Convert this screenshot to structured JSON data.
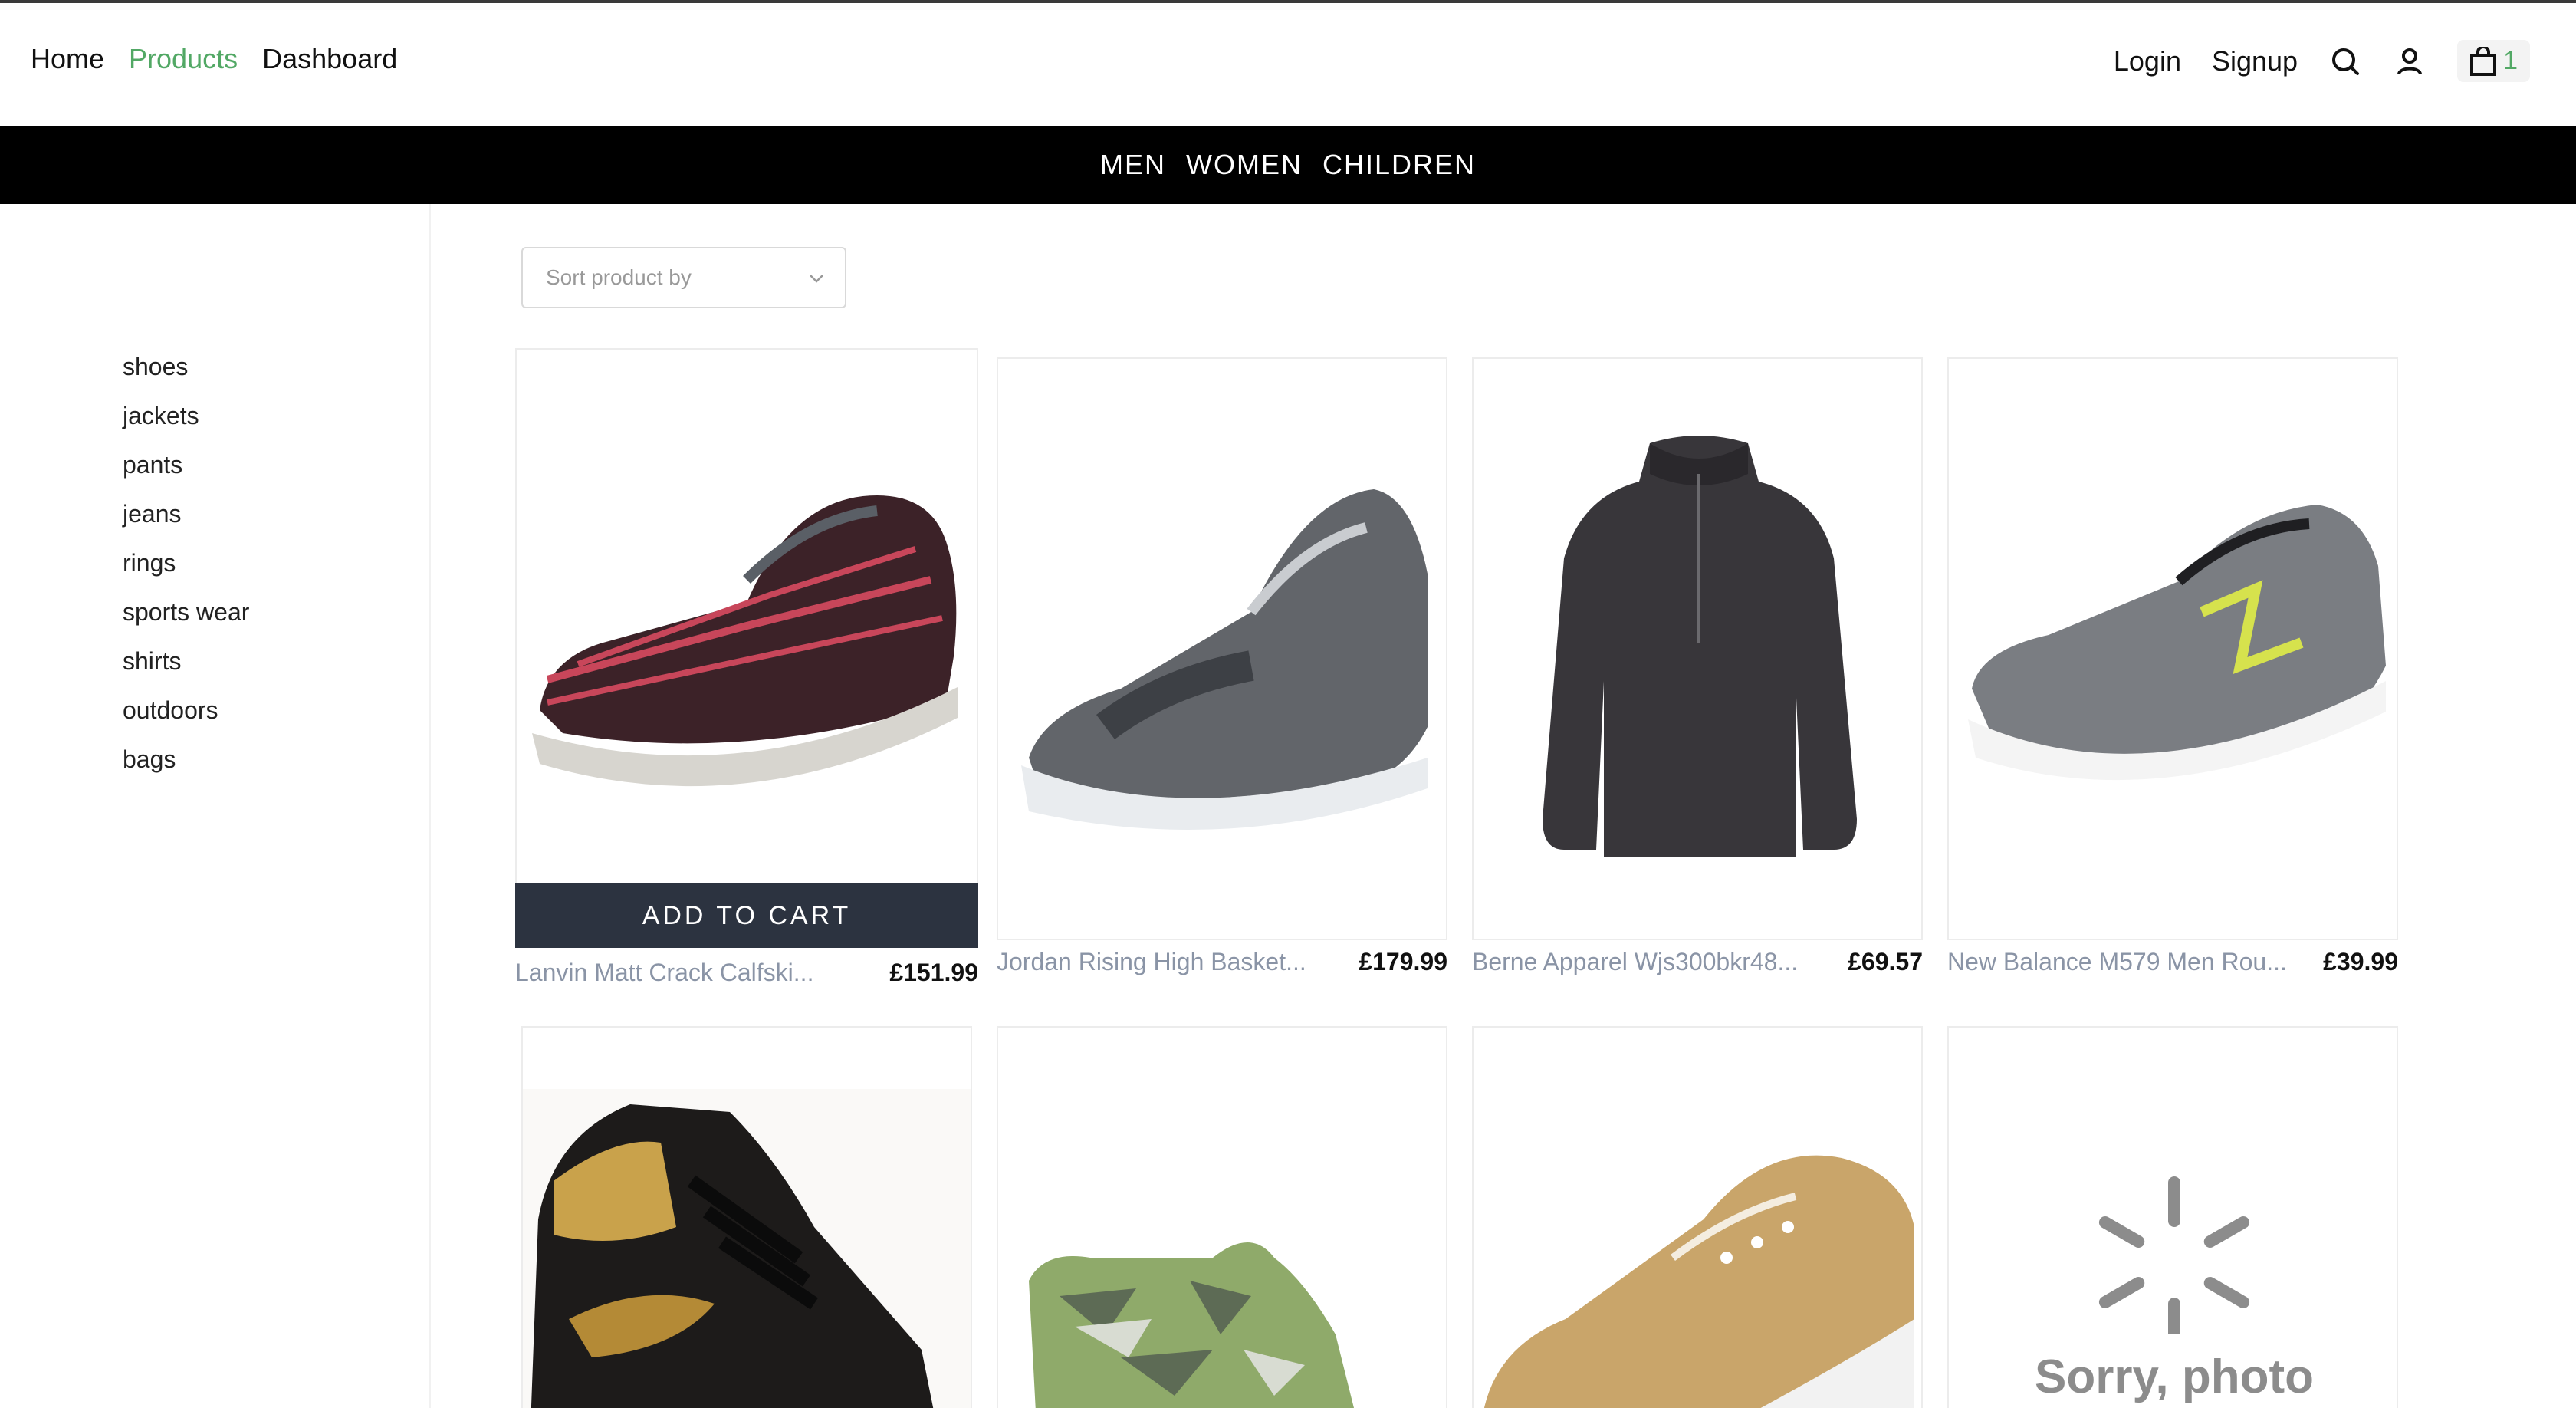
{
  "header": {
    "nav": [
      {
        "label": "Home",
        "active": false
      },
      {
        "label": "Products",
        "active": true
      },
      {
        "label": "Dashboard",
        "active": false
      }
    ],
    "login": "Login",
    "signup": "Signup",
    "cart_count": "1",
    "icons": [
      "search-icon",
      "user-icon",
      "shopping-bag-icon"
    ]
  },
  "categories": [
    "MEN",
    "WOMEN",
    "CHILDREN"
  ],
  "sidebar": {
    "items": [
      "shoes",
      "jackets",
      "pants",
      "jeans",
      "rings",
      "sports wear",
      "shirts",
      "outdoors",
      "bags"
    ]
  },
  "sort": {
    "placeholder": "Sort product by"
  },
  "add_to_cart": "ADD TO CART",
  "products": [
    {
      "name": "Lanvin Matt Crack Calfski...",
      "price": "£151.99"
    },
    {
      "name": "Jordan Rising High Basket...",
      "price": "£179.99"
    },
    {
      "name": "Berne Apparel Wjs300bkr48...",
      "price": "£69.57"
    },
    {
      "name": "New Balance M579 Men Rou...",
      "price": "£39.99"
    }
  ],
  "placeholder_image_text": "Sorry, photo",
  "colors": {
    "accent": "#52a865",
    "category_bar": "#000000",
    "add_to_cart_bg": "#2c3340"
  }
}
